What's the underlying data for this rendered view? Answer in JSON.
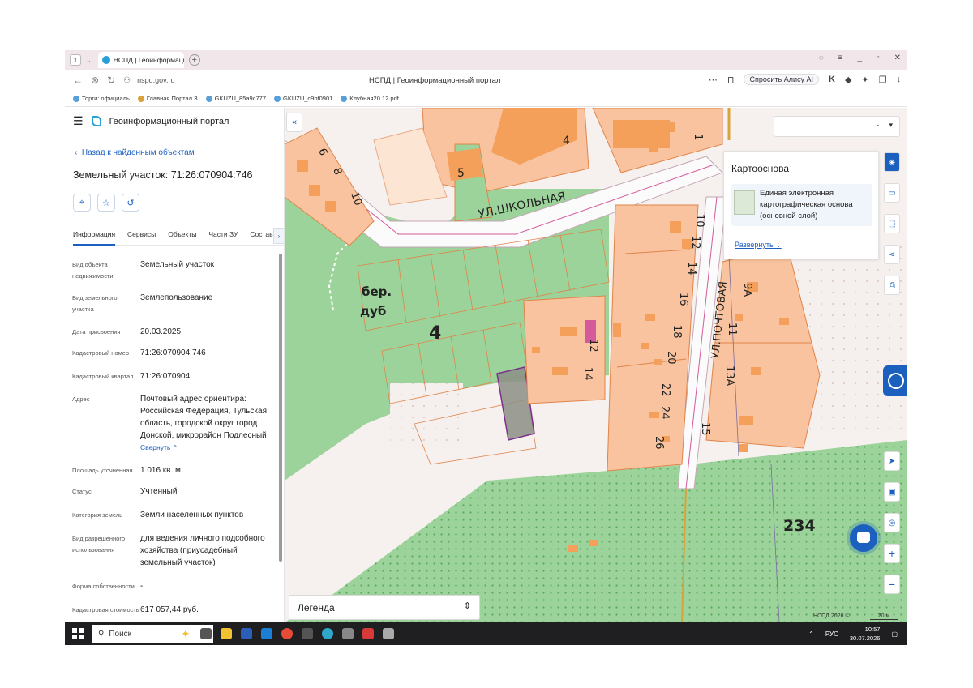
{
  "browser": {
    "tab_count": "1",
    "tab_title": "НСПД | Геоинформацио",
    "url": "nspd.gov.ru",
    "page_title": "НСПД | Геоинформационный портал",
    "alisa_label": "Спросить Алису AI",
    "bookmarks": [
      "Торги: официаль",
      "Главная Портал З",
      "GKUZU_85a9c777",
      "GKUZU_c9bf0901",
      "Клубная20 12.pdf"
    ]
  },
  "panel": {
    "portal_title": "Геоинформационный портал",
    "back_label": "Назад к найденным объектам",
    "parcel_title": "Земельный участок: 71:26:070904:746",
    "tabs": [
      "Информация",
      "Сервисы",
      "Объекты",
      "Части ЗУ",
      "Состав"
    ],
    "rows": [
      {
        "k": "Вид объекта недвижимости",
        "v": "Земельный участок"
      },
      {
        "k": "Вид земельного участка",
        "v": "Землепользование"
      },
      {
        "k": "Дата присвоения",
        "v": "20.03.2025"
      },
      {
        "k": "Кадастровый номер",
        "v": "71:26:070904:746"
      },
      {
        "k": "Кадастровый квартал",
        "v": "71:26:070904"
      },
      {
        "k": "Адрес",
        "v": "Почтовый адрес ориентира: Российская Федерация, Тульская область, городской округ город Донской, микрорайон Подлесный"
      },
      {
        "k": "Площадь уточненная",
        "v": "1 016 кв. м"
      },
      {
        "k": "Статус",
        "v": "Учтенный"
      },
      {
        "k": "Категория земель",
        "v": "Земли населенных пунктов"
      },
      {
        "k": "Вид разрешенного использования",
        "v": "для ведения личного подсобного хозяйства (приусадебный земельный участок)"
      },
      {
        "k": "Форма собственности",
        "v": "-"
      },
      {
        "k": "Кадастровая стоимость",
        "v": "617 057,44 руб."
      }
    ],
    "collapse_label": "Свернуть"
  },
  "map": {
    "search_select": "-",
    "basemap_title": "Картооснова",
    "basemap_layer": "Единая электронная картографическая основа (основной слой)",
    "expand_label": "Развернуть",
    "legend_label": "Легенда",
    "copyright": "НСПД 2026 ©",
    "scale": "20 м",
    "labels": {
      "street_school": "УЛ.ШКОЛЬНАЯ",
      "street_post": "УЛ.ПОЧТОВАЯ",
      "forest_a": "бер.",
      "forest_b": "дуб",
      "tree_height": "4",
      "n234": "234",
      "h5": "5",
      "h4": "4",
      "h6": "6",
      "h8": "8",
      "h10": "10",
      "h1": "1",
      "h10b": "10",
      "h12": "12",
      "h14": "14",
      "h16": "16",
      "h18": "18",
      "h20": "20",
      "h22": "22",
      "h24": "24",
      "h26": "26",
      "h12b": "12",
      "h14b": "14",
      "h9a": "9А",
      "h11": "11",
      "h13a": "13А",
      "h15": "15"
    }
  },
  "taskbar": {
    "search_label": "Поиск",
    "lang": "РУС",
    "time": "10:57",
    "date": "30.07.2026"
  },
  "colors": {
    "accent": "#1b5fbf",
    "forest": "#9bd39a",
    "parcel": "#f8c39e",
    "building": "#f4a05a",
    "selected_parcel": "#8c8f86",
    "road_line": "#d45a9b"
  }
}
